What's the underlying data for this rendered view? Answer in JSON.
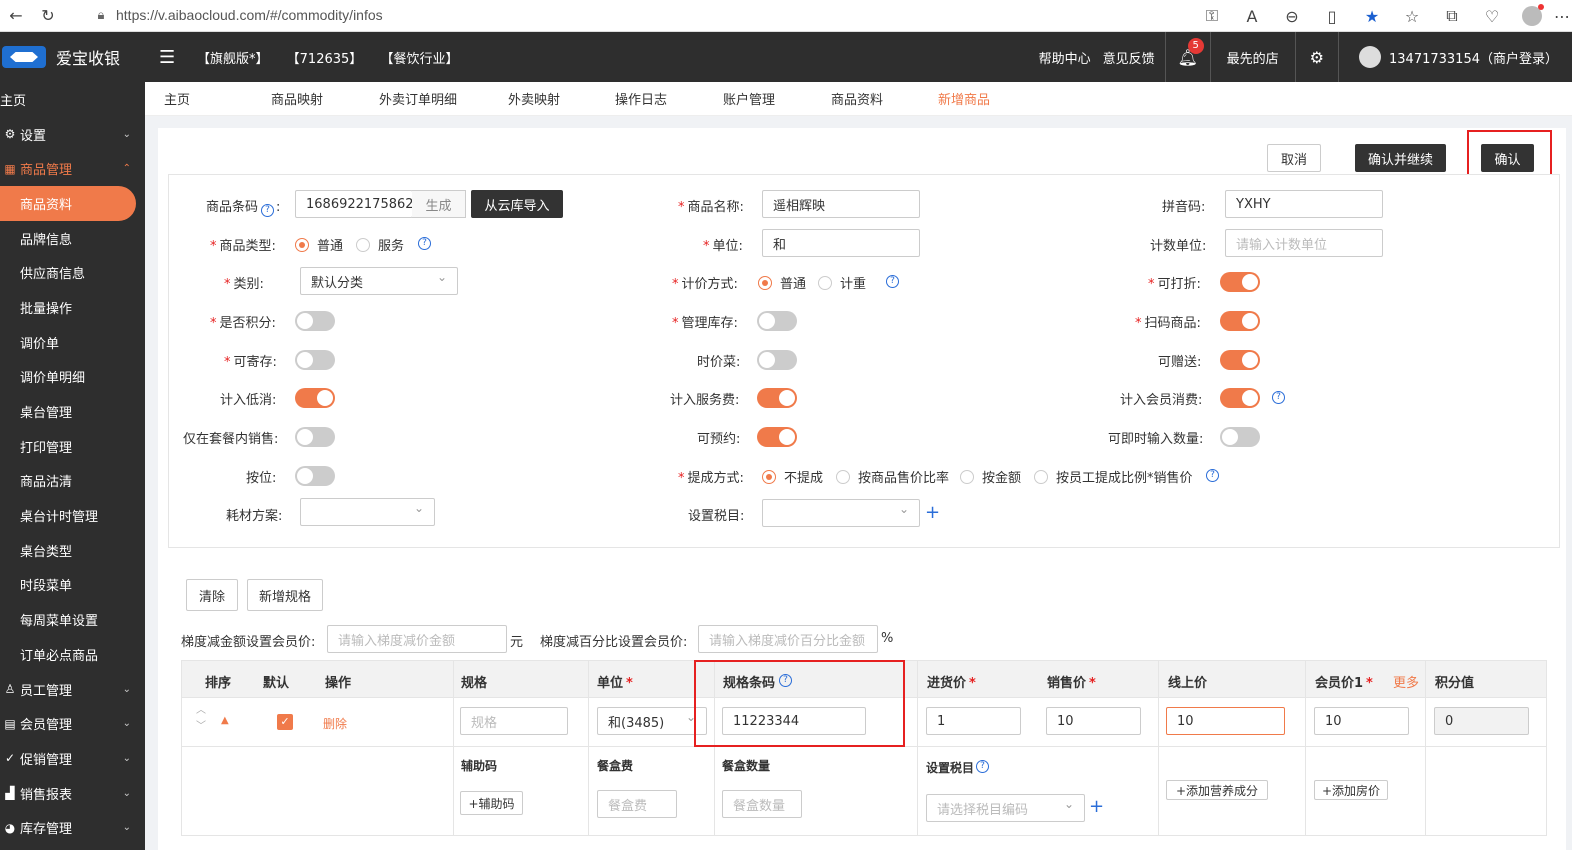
{
  "browser": {
    "url": "https://v.aibaocloud.com/#/commodity/infos"
  },
  "header": {
    "app_name": "爱宝收银",
    "tags": [
      "【旗舰版*】",
      "【712635】",
      "【餐饮行业】"
    ],
    "help": "帮助中心",
    "feedback": "意见反馈",
    "notif_count": "5",
    "store": "最先的店",
    "user": "13471733154（商户登录）"
  },
  "sidebar": {
    "home": "主页",
    "settings": "设置",
    "product_mgmt": "商品管理",
    "items": [
      "商品资料",
      "品牌信息",
      "供应商信息",
      "批量操作",
      "调价单",
      "调价单明细",
      "桌台管理",
      "打印管理",
      "商品沽清",
      "桌台计时管理",
      "桌台类型",
      "时段菜单",
      "每周菜单设置",
      "订单必点商品"
    ],
    "groups": [
      "员工管理",
      "会员管理",
      "促销管理",
      "销售报表",
      "库存管理"
    ]
  },
  "tabs": [
    "主页",
    "商品映射",
    "外卖订单明细",
    "外卖映射",
    "操作日志",
    "账户管理",
    "商品资料",
    "新增商品"
  ],
  "actions": {
    "cancel": "取消",
    "confirm_continue": "确认并继续",
    "confirm": "确认"
  },
  "form": {
    "barcode_label": "商品条码",
    "barcode_value": "1686922175862",
    "generate": "生成",
    "cloud_import": "从云库导入",
    "name_label": "商品名称:",
    "name_value": "遥相辉映",
    "pinyin_label": "拼音码:",
    "pinyin_value": "YXHY",
    "type_label": "商品类型:",
    "type_normal": "普通",
    "type_service": "服务",
    "unit_label": "单位:",
    "unit_value": "和",
    "count_unit_label": "计数单位:",
    "count_unit_placeholder": "请输入计数单位",
    "category_label": "类别:",
    "category_value": "默认分类",
    "pricing_label": "计价方式:",
    "pricing_normal": "普通",
    "pricing_weight": "计重",
    "discountable_label": "可打折:",
    "points_label": "是否积分:",
    "stock_label": "管理库存:",
    "scan_label": "扫码商品:",
    "deposit_label": "可寄存:",
    "seasonal_label": "时价菜:",
    "gift_label": "可赠送:",
    "min_spend_label": "计入低消:",
    "service_fee_label": "计入服务费:",
    "member_spend_label": "计入会员消费:",
    "combo_only_label": "仅在套餐内销售:",
    "reservable_label": "可预约:",
    "instant_qty_label": "可即时输入数量:",
    "by_position_label": "按位:",
    "commission_label": "提成方式:",
    "commission_opts": [
      "不提成",
      "按商品售价比率",
      "按金额",
      "按员工提成比例*销售价"
    ],
    "material_label": "耗材方案:",
    "tax_label": "设置税目:"
  },
  "spec": {
    "clear": "清除",
    "add_spec": "新增规格",
    "tier_amount_label": "梯度减金额设置会员价:",
    "tier_amount_placeholder": "请输入梯度减价金额",
    "yuan": "元",
    "tier_pct_label": "梯度减百分比设置会员价:",
    "tier_pct_placeholder": "请输入梯度减价百分比金额",
    "pct": "%",
    "headers": {
      "sort": "排序",
      "default": "默认",
      "op": "操作",
      "spec": "规格",
      "unit": "单位",
      "barcode": "规格条码",
      "cost": "进货价",
      "price": "销售价",
      "online": "线上价",
      "member": "会员价1",
      "more": "更多",
      "points": "积分值"
    },
    "row": {
      "delete": "删除",
      "spec_placeholder": "规格",
      "unit": "和(3485)",
      "barcode": "11223344",
      "cost": "1",
      "price": "10",
      "online": "10",
      "member": "10",
      "points": "0"
    },
    "sub": {
      "aux_code": "辅助码",
      "aux_code_btn": "+辅助码",
      "box_fee": "餐盒费",
      "box_fee_placeholder": "餐盒费",
      "box_qty": "餐盒数量",
      "box_qty_placeholder": "餐盒数量",
      "tax": "设置税目",
      "tax_placeholder": "请选择税目编码",
      "nutrition_btn": "+添加营养成分",
      "room_price_btn": "+添加房价"
    }
  }
}
